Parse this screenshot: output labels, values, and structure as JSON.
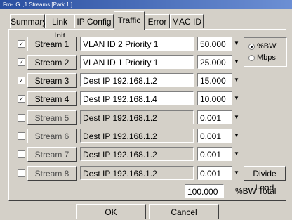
{
  "window": {
    "title": "Fm- iG i,1 Streams [Park 1 ]"
  },
  "tabs": [
    {
      "label": "Summary"
    },
    {
      "label": "Link Init"
    },
    {
      "label": "IP Config"
    },
    {
      "label": "Traffic",
      "active": true
    },
    {
      "label": "Error"
    },
    {
      "label": "MAC ID"
    }
  ],
  "streams": [
    {
      "checked": true,
      "button": "Stream 1",
      "desc": "VLAN ID 2    Priority 1",
      "value": "50.000",
      "enabled": true
    },
    {
      "checked": true,
      "button": "Stream 2",
      "desc": "VLAN ID 1    Priority 1",
      "value": "25.000",
      "enabled": true
    },
    {
      "checked": true,
      "button": "Stream 3",
      "desc": "Dest IP 192.168.1.2",
      "value": "15.000",
      "enabled": true
    },
    {
      "checked": true,
      "button": "Stream 4",
      "desc": "Dest IP 192.168.1.4",
      "value": "10.000",
      "enabled": true
    },
    {
      "checked": false,
      "button": "Stream 5",
      "desc": "Dest IP 192.168.1.2",
      "value": "0.001",
      "enabled": false
    },
    {
      "checked": false,
      "button": "Stream 6",
      "desc": "Dest IP 192.168.1.2",
      "value": "0.001",
      "enabled": false
    },
    {
      "checked": false,
      "button": "Stream 7",
      "desc": "Dest IP 192.168.1.2",
      "value": "0.001",
      "enabled": false
    },
    {
      "checked": false,
      "button": "Stream 8",
      "desc": "Dest IP 192.168.1.2",
      "value": "0.001",
      "enabled": false
    }
  ],
  "units": {
    "bw_label": "%BW",
    "mbps_label": "Mbps",
    "selected": "%BW"
  },
  "divide_load": "Divide Load",
  "total": {
    "value": "100.000",
    "label": "%BW Total"
  },
  "footer": {
    "ok": "OK",
    "cancel": "Cancel"
  },
  "icons": {
    "check": "checkmark-icon",
    "spin": "spin-down-icon"
  },
  "colors": {
    "face": "#d4d0c8",
    "titlebar": "#2a4fa0"
  }
}
